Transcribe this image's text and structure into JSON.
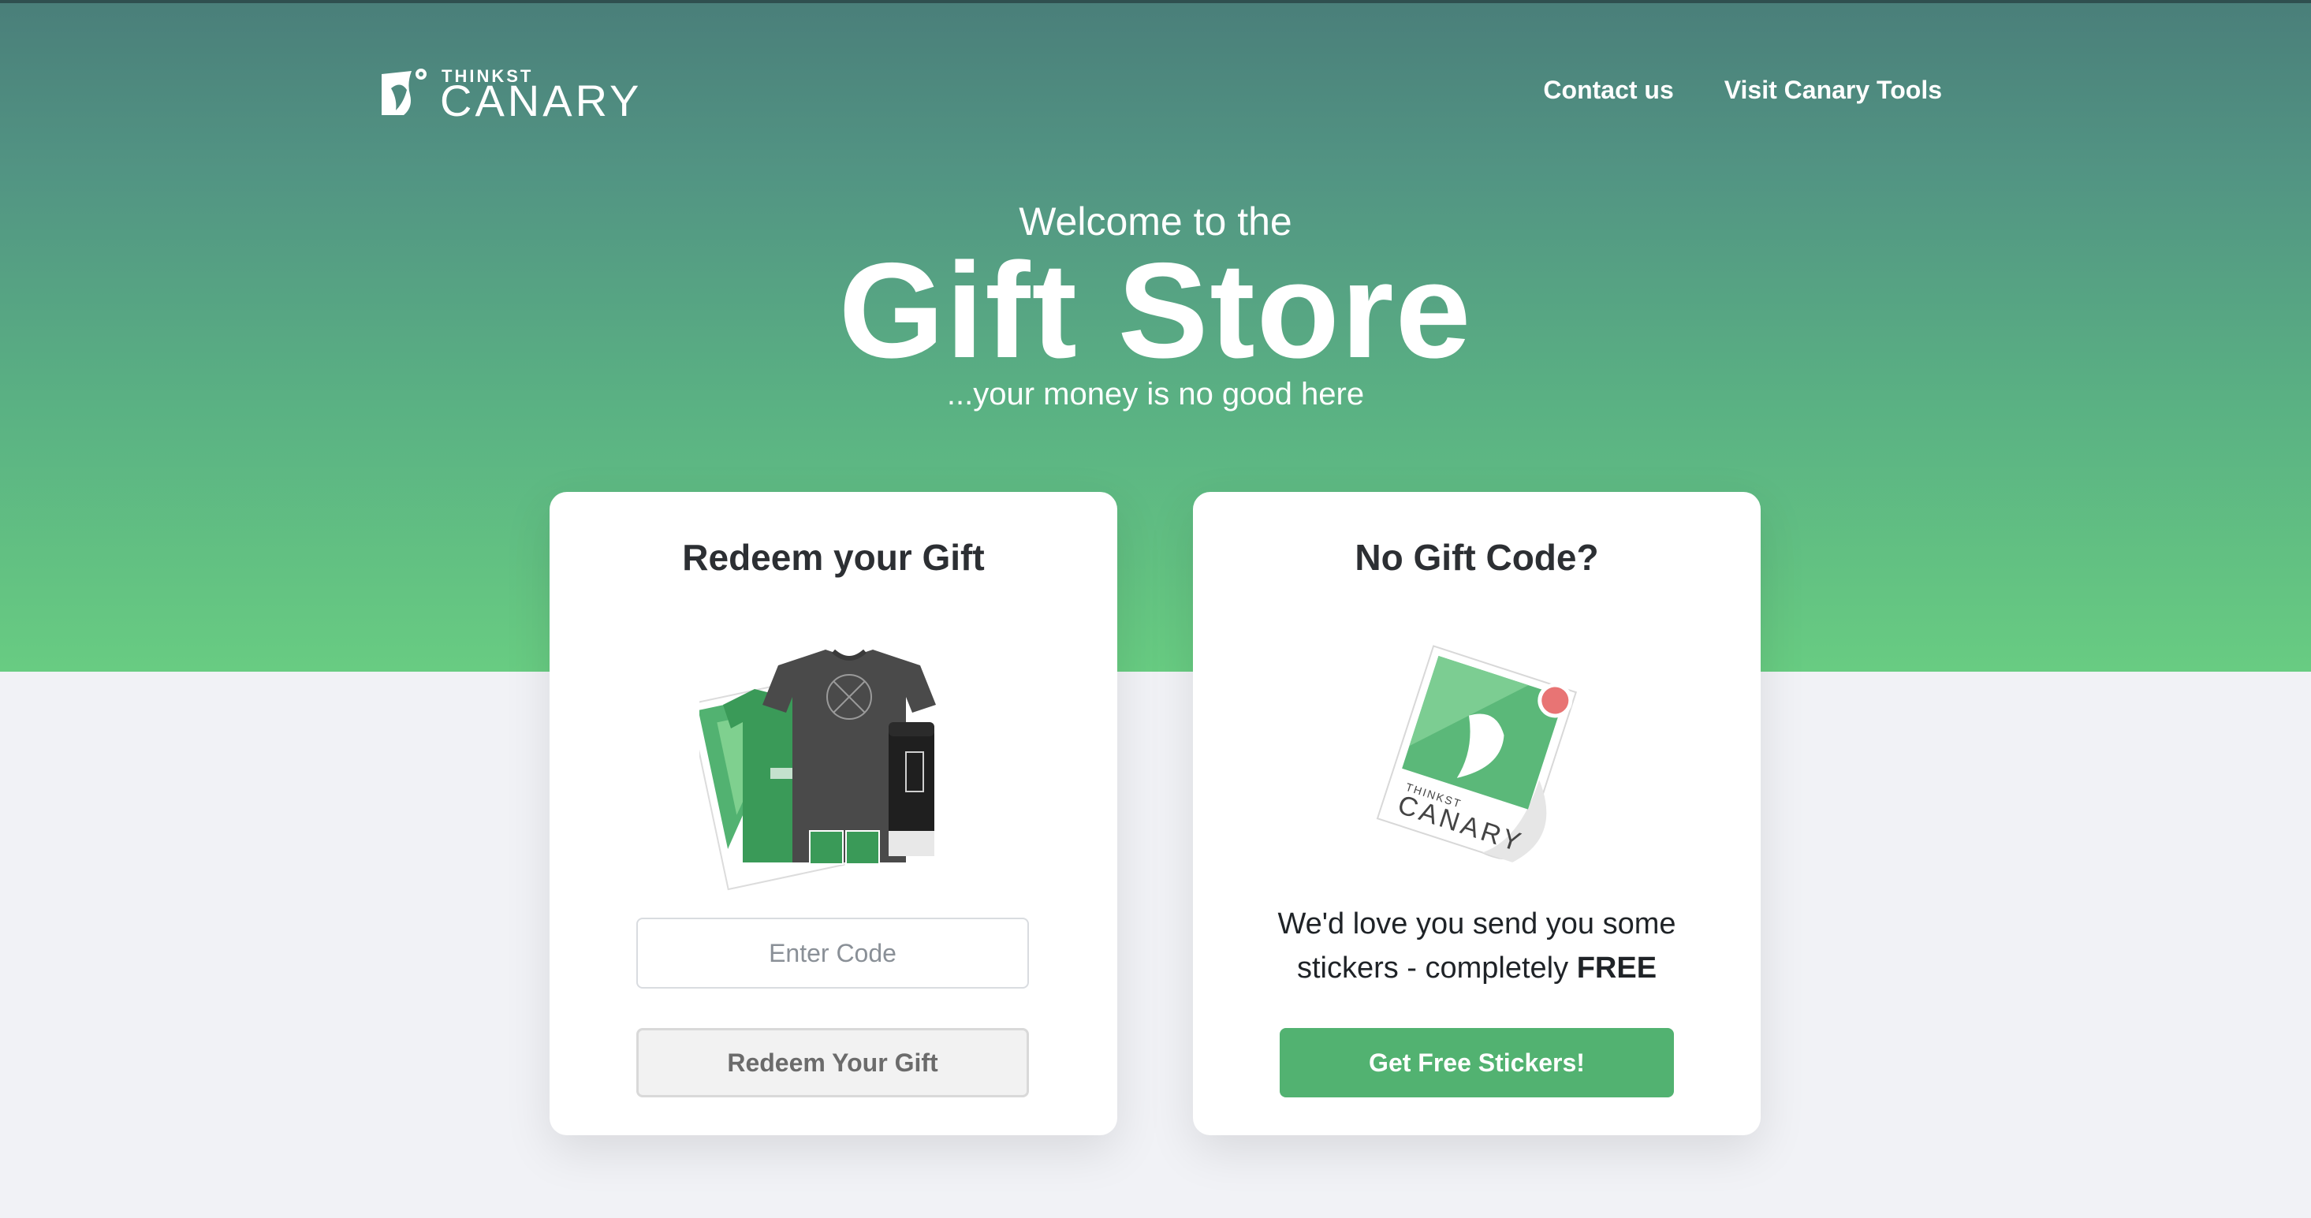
{
  "header": {
    "logo_top": "THINKST",
    "logo_main": "CANARY",
    "nav": [
      {
        "label": "Contact us"
      },
      {
        "label": "Visit Canary Tools"
      }
    ]
  },
  "hero": {
    "welcome": "Welcome to the",
    "title": "Gift Store",
    "tagline": "...your money is no good here"
  },
  "redeem_card": {
    "title": "Redeem your Gift",
    "input_placeholder": "Enter Code",
    "input_value": "",
    "button_label": "Redeem Your Gift"
  },
  "sticker_card": {
    "title": "No Gift Code?",
    "text_part1": "We'd love you send you some stickers - completely ",
    "text_bold": "FREE",
    "sticker_brand_small": "THINKST",
    "sticker_brand": "CANARY",
    "button_label": "Get Free Stickers!"
  },
  "colors": {
    "hero_top": "#4a7f7a",
    "hero_bottom": "#68cc82",
    "accent_green": "#52b271",
    "page_bg": "#f1f2f6",
    "sticker_dot": "#e87474"
  },
  "icons": [
    "canary-logo-icon",
    "gift-bundle-illustration",
    "canary-sticker-illustration"
  ]
}
